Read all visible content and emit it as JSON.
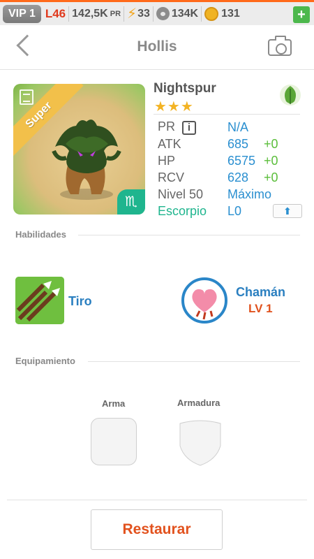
{
  "status_bar": {
    "vip": "VIP 1",
    "level": "L46",
    "power": "142,5K",
    "power_unit": "PR",
    "energy": "33",
    "paws": "134K",
    "coins": "131",
    "add_label": "+"
  },
  "header": {
    "title": "Hollis"
  },
  "monster": {
    "rarity": "Super",
    "name": "Nightspur",
    "stars": "★★★",
    "element": "leaf-icon",
    "zodiac_symbol": "♏",
    "stats": {
      "pr_label": "PR",
      "pr_info": "i",
      "pr_value": "N/A",
      "atk_label": "ATK",
      "atk_value": "685",
      "atk_bonus": "+0",
      "hp_label": "HP",
      "hp_value": "6575",
      "hp_bonus": "+0",
      "rcv_label": "RCV",
      "rcv_value": "628",
      "rcv_bonus": "+0",
      "level_label": "Nivel 50",
      "level_value": "Máximo",
      "zodiac_label": "Escorpio",
      "zodiac_value": "L0"
    }
  },
  "abilities": {
    "section_label": "Habilidades",
    "skill": {
      "name": "Tiro"
    },
    "leader": {
      "name": "Chamán",
      "level": "LV 1"
    }
  },
  "equipment": {
    "section_label": "Equipamiento",
    "weapon_label": "Arma",
    "armor_label": "Armadura"
  },
  "footer": {
    "restore_label": "Restaurar"
  },
  "colors": {
    "accent_orange": "#e2521e",
    "stat_blue": "#2a8fd0",
    "bonus_green": "#5bbe3b",
    "zodiac_teal": "#1fb58e"
  }
}
